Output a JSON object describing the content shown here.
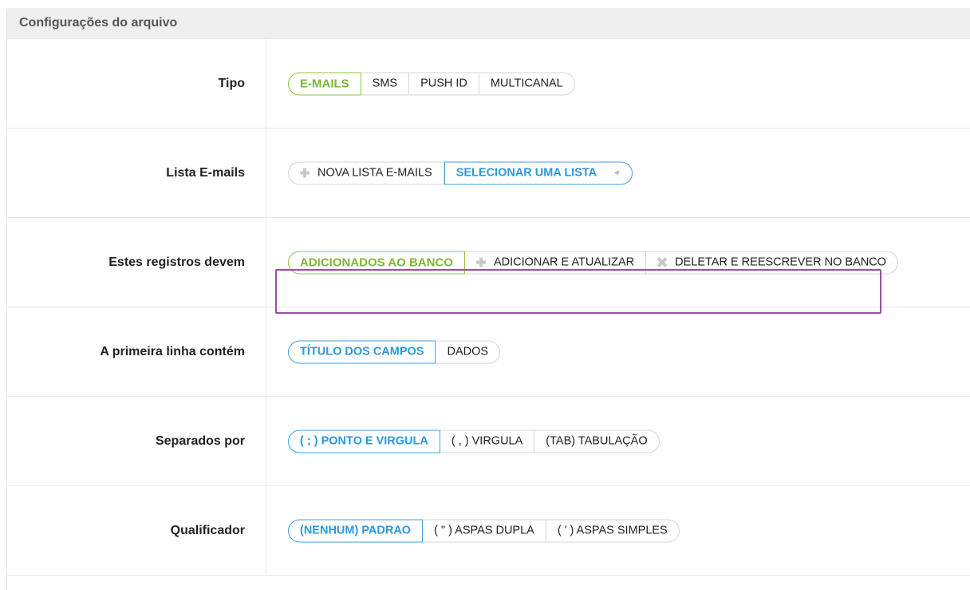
{
  "panel": {
    "title": "Configurações do arquivo"
  },
  "rows": [
    {
      "label": "Tipo",
      "options": [
        "E-MAILS",
        "SMS",
        "PUSH ID",
        "MULTICANAL"
      ]
    },
    {
      "label": "Lista E-mails",
      "new_list": "NOVA LISTA E-MAILS",
      "select_list": "SELECIONAR UMA LISTA"
    },
    {
      "label": "Estes registros devem",
      "options": [
        "ADICIONADOS AO BANCO",
        "ADICIONAR E ATUALIZAR",
        "DELETAR E REESCREVER NO BANCO"
      ]
    },
    {
      "label": "A primeira linha contém",
      "options": [
        "TÍTULO DOS CAMPOS",
        "DADOS"
      ]
    },
    {
      "label": "Separados por",
      "options": [
        "( ; ) PONTO E VIRGULA",
        "( , ) VIRGULA",
        "(TAB) TABULAÇÃO"
      ]
    },
    {
      "label": "Qualificador",
      "options": [
        "(NENHUM) PADRAO",
        "( \" ) ASPAS DUPLA",
        "( ' ) ASPAS SIMPLES"
      ]
    }
  ],
  "icons": {
    "add": "plus-icon",
    "delete": "x-icon",
    "dropdown": "caret-down-icon"
  },
  "colors": {
    "active_green": "#8dc63f",
    "active_blue": "#2b98dc",
    "highlight": "#9a4ea6"
  }
}
